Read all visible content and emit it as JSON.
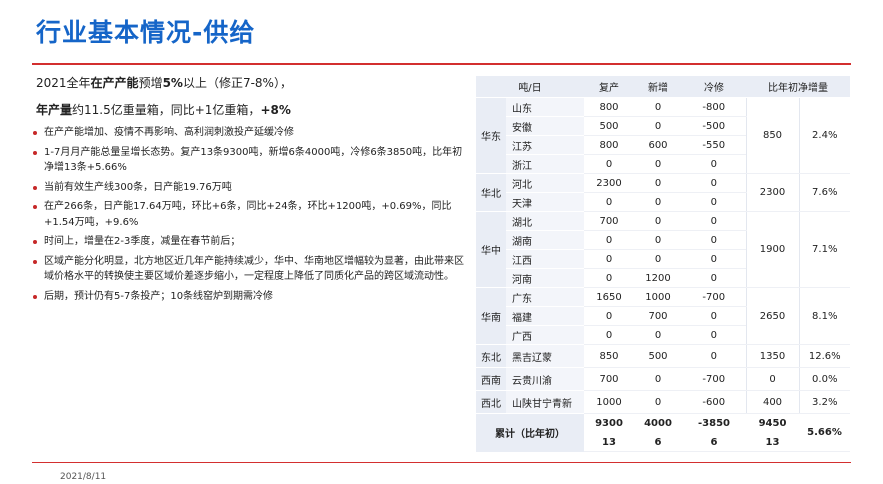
{
  "title": "行业基本情况-供给",
  "footer_date": "2021/8/11",
  "intro": {
    "line1_prefix": "2021全年",
    "line1_bold1": "在产产能",
    "line1_mid": "预增",
    "line1_bold2": "5%",
    "line1_suffix": "以上（修正7-8%），",
    "line2_bold": "年产量",
    "line2_mid": "约11.5亿重量箱，同比+1亿重箱，",
    "line2_bold2": "+8%"
  },
  "bullets": [
    "在产产能增加、疫情不再影响、高利润刺激投产延缓冷修",
    "1-7月月产能总量呈增长态势。复产13条9300吨，新增6条4000吨，冷修6条3850吨，比年初净增13条+5.66%",
    "当前有效生产线300条，日产能19.76万吨",
    "在产266条，日产能17.64万吨，环比+6条，同比+24条，环比+1200吨，+0.69%，同比+1.54万吨，+9.6%",
    "时间上，增量在2-3季度，减量在春节前后；",
    "区域产能分化明显，北方地区近几年产能持续减少，华中、华南地区增幅较为显著，由此带来区域价格水平的转换使主要区域价差逐步缩小，一定程度上降低了同质化产品的跨区域流动性。",
    "后期，预计仍有5-7条投产；10条线窑炉到期需冷修"
  ],
  "table": {
    "headers": [
      "吨/日",
      "复产",
      "新增",
      "冷修",
      "比年初净增量"
    ],
    "regions": [
      {
        "name": "华东",
        "sum": "850",
        "pct": "2.4%",
        "rows": [
          {
            "prov": "山东",
            "a": "800",
            "b": "0",
            "c": "-800"
          },
          {
            "prov": "安徽",
            "a": "500",
            "b": "0",
            "c": "-500"
          },
          {
            "prov": "江苏",
            "a": "800",
            "b": "600",
            "c": "-550"
          },
          {
            "prov": "浙江",
            "a": "0",
            "b": "0",
            "c": "0"
          }
        ]
      },
      {
        "name": "华北",
        "sum": "2300",
        "pct": "7.6%",
        "rows": [
          {
            "prov": "河北",
            "a": "2300",
            "b": "0",
            "c": "0"
          },
          {
            "prov": "天津",
            "a": "0",
            "b": "0",
            "c": "0"
          }
        ]
      },
      {
        "name": "华中",
        "sum": "1900",
        "pct": "7.1%",
        "rows": [
          {
            "prov": "湖北",
            "a": "700",
            "b": "0",
            "c": "0"
          },
          {
            "prov": "湖南",
            "a": "0",
            "b": "0",
            "c": "0"
          },
          {
            "prov": "江西",
            "a": "0",
            "b": "0",
            "c": "0"
          },
          {
            "prov": "河南",
            "a": "0",
            "b": "1200",
            "c": "0"
          }
        ]
      },
      {
        "name": "华南",
        "sum": "2650",
        "pct": "8.1%",
        "rows": [
          {
            "prov": "广东",
            "a": "1650",
            "b": "1000",
            "c": "-700"
          },
          {
            "prov": "福建",
            "a": "0",
            "b": "700",
            "c": "0"
          },
          {
            "prov": "广西",
            "a": "0",
            "b": "0",
            "c": "0"
          }
        ]
      },
      {
        "name": "东北",
        "sum": "1350",
        "pct": "12.6%",
        "rows": [
          {
            "prov": "黑吉辽蒙",
            "a": "850",
            "b": "500",
            "c": "0"
          }
        ]
      },
      {
        "name": "西南",
        "sum": "0",
        "pct": "0.0%",
        "rows": [
          {
            "prov": "云贵川渝",
            "a": "700",
            "b": "0",
            "c": "-700"
          }
        ]
      },
      {
        "name": "西北",
        "sum": "400",
        "pct": "3.2%",
        "rows": [
          {
            "prov": "山陕甘宁青新",
            "a": "1000",
            "b": "0",
            "c": "-600"
          }
        ]
      }
    ],
    "total": {
      "label": "累计（比年初）",
      "a1": "9300",
      "a2": "13",
      "b1": "4000",
      "b2": "6",
      "c1": "-3850",
      "c2": "6",
      "s1": "9450",
      "s2": "13",
      "pct": "5.66%"
    }
  },
  "colors": {
    "title": "#1565c8",
    "rule": "#d32f2f",
    "bullet": "#c62828",
    "table_header": "#e9edf5"
  }
}
